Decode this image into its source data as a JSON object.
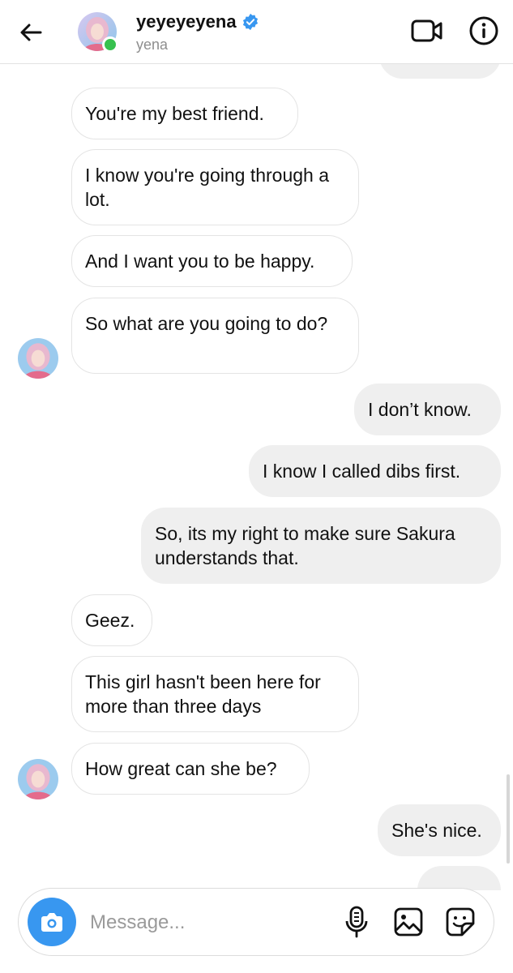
{
  "header": {
    "username": "yeyeyeyena",
    "subname": "yena",
    "verified": true,
    "online": true
  },
  "messages": [
    {
      "side": "incoming",
      "text": "You're my best friend."
    },
    {
      "side": "incoming",
      "text": "I know you're going through a lot."
    },
    {
      "side": "incoming",
      "text": "And I want you to be happy."
    },
    {
      "side": "incoming",
      "text": "So what are you going to do?"
    },
    {
      "side": "outgoing",
      "text": "I don’t know."
    },
    {
      "side": "outgoing",
      "text": "I know I called dibs first."
    },
    {
      "side": "outgoing",
      "text": "So, its my right to make sure Sakura understands that."
    },
    {
      "side": "incoming",
      "text": "Geez."
    },
    {
      "side": "incoming",
      "text": "This girl hasn't been here for more than three days"
    },
    {
      "side": "incoming",
      "text": "How great can she be?"
    },
    {
      "side": "outgoing",
      "text": "She's nice."
    }
  ],
  "composer": {
    "placeholder": "Message..."
  },
  "colors": {
    "accent": "#3897f0",
    "online": "#37c14f",
    "outgoing_bubble": "#efefef",
    "incoming_border": "#e4e4e4"
  },
  "icons": [
    "back-arrow-icon",
    "verified-badge-icon",
    "video-call-icon",
    "info-icon",
    "camera-icon",
    "microphone-icon",
    "gallery-icon",
    "sticker-icon"
  ]
}
